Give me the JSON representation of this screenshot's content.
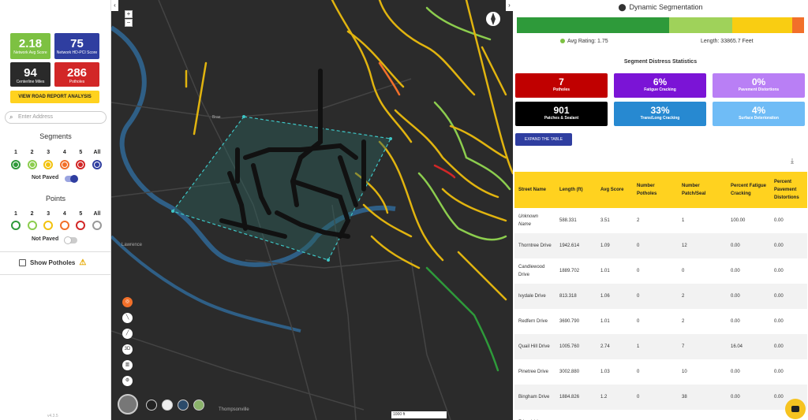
{
  "left": {
    "cards": [
      {
        "value": "2.18",
        "label": "Network Avg Score",
        "color": "#7dc142"
      },
      {
        "value": "75",
        "label": "Network HD-PCI Score",
        "color": "#2f3ea0"
      },
      {
        "value": "94",
        "label": "Centerline Miles",
        "color": "#2a2a2a"
      },
      {
        "value": "286",
        "label": "Potholes",
        "color": "#d22727"
      }
    ],
    "road_report_button": "VIEW ROAD REPORT ANALYSIS",
    "address_placeholder": "Enter Address",
    "segments_title": "Segments",
    "segment_numbers": [
      "1",
      "2",
      "3",
      "4",
      "5",
      "All"
    ],
    "not_paved_label": "Not Paved",
    "points_title": "Points",
    "point_numbers": [
      "1",
      "2",
      "3",
      "4",
      "5",
      "All"
    ],
    "points_not_paved_label": "Not Paved",
    "show_potholes_label": "Show Potholes",
    "version": "v4.3.5"
  },
  "map": {
    "zoom_in": "+",
    "zoom_out": "−",
    "scale_label": "1000 ft",
    "labels": {
      "lawrence": "Lawrence",
      "thompsonville": "Thompsonville",
      "brae": "Brae"
    }
  },
  "right": {
    "title": "Dynamic Segmentation",
    "rating_bar": [
      {
        "fraction": 0.53,
        "color": "#2e9a3a"
      },
      {
        "fraction": 0.22,
        "color": "#9fd25a"
      },
      {
        "fraction": 0.21,
        "color": "#f9cd12"
      },
      {
        "fraction": 0.04,
        "color": "#f2702a"
      }
    ],
    "avg_rating": "Avg Rating: 1.75",
    "length": "Length: 33865.7 Feet",
    "stats_title": "Segment Distress Statistics",
    "stats": [
      {
        "value": "7",
        "label": "Potholes",
        "color": "#c00000"
      },
      {
        "value": "6%",
        "label": "Fatigue Cracking",
        "color": "#7b14d6"
      },
      {
        "value": "0%",
        "label": "Pavement Distortions",
        "color": "#b97ff5"
      },
      {
        "value": "901",
        "label": "Patches & Sealant",
        "color": "#000000"
      },
      {
        "value": "33%",
        "label": "Trans/Long Cracking",
        "color": "#2789d1"
      },
      {
        "value": "4%",
        "label": "Surface Deterioration",
        "color": "#6fbcf6"
      }
    ],
    "expand_button": "EXPAND THE TABLE",
    "table": {
      "headers": [
        "Street Name",
        "Length (ft)",
        "Avg Score",
        "Number Potholes",
        "Number Patch/Seal",
        "Percent Fatigue Cracking",
        "Percent Pavement Distortions"
      ],
      "rows": [
        [
          "Unknown Name",
          "588.331",
          "3.51",
          "2",
          "1",
          "100.00",
          "0.00"
        ],
        [
          "Thorntree Drive",
          "1942.614",
          "1.09",
          "0",
          "12",
          "0.00",
          "0.00"
        ],
        [
          "Candlewood Drive",
          "1889.702",
          "1.01",
          "0",
          "0",
          "0.00",
          "0.00"
        ],
        [
          "Ivydale Drive",
          "813.318",
          "1.06",
          "0",
          "2",
          "0.00",
          "0.00"
        ],
        [
          "Redfern Drive",
          "3690.790",
          "1.01",
          "0",
          "2",
          "0.00",
          "0.00"
        ],
        [
          "Quail Hill Drive",
          "1005.760",
          "2.74",
          "1",
          "7",
          "16.04",
          "0.00"
        ],
        [
          "Pinetree Drive",
          "3002.880",
          "1.03",
          "0",
          "10",
          "0.00",
          "0.00"
        ],
        [
          "Bingham Drive",
          "1884.826",
          "1.2",
          "0",
          "38",
          "0.00",
          "0.00"
        ],
        [
          "Friendship",
          "",
          "",
          "",
          "",
          "",
          ""
        ]
      ]
    }
  }
}
